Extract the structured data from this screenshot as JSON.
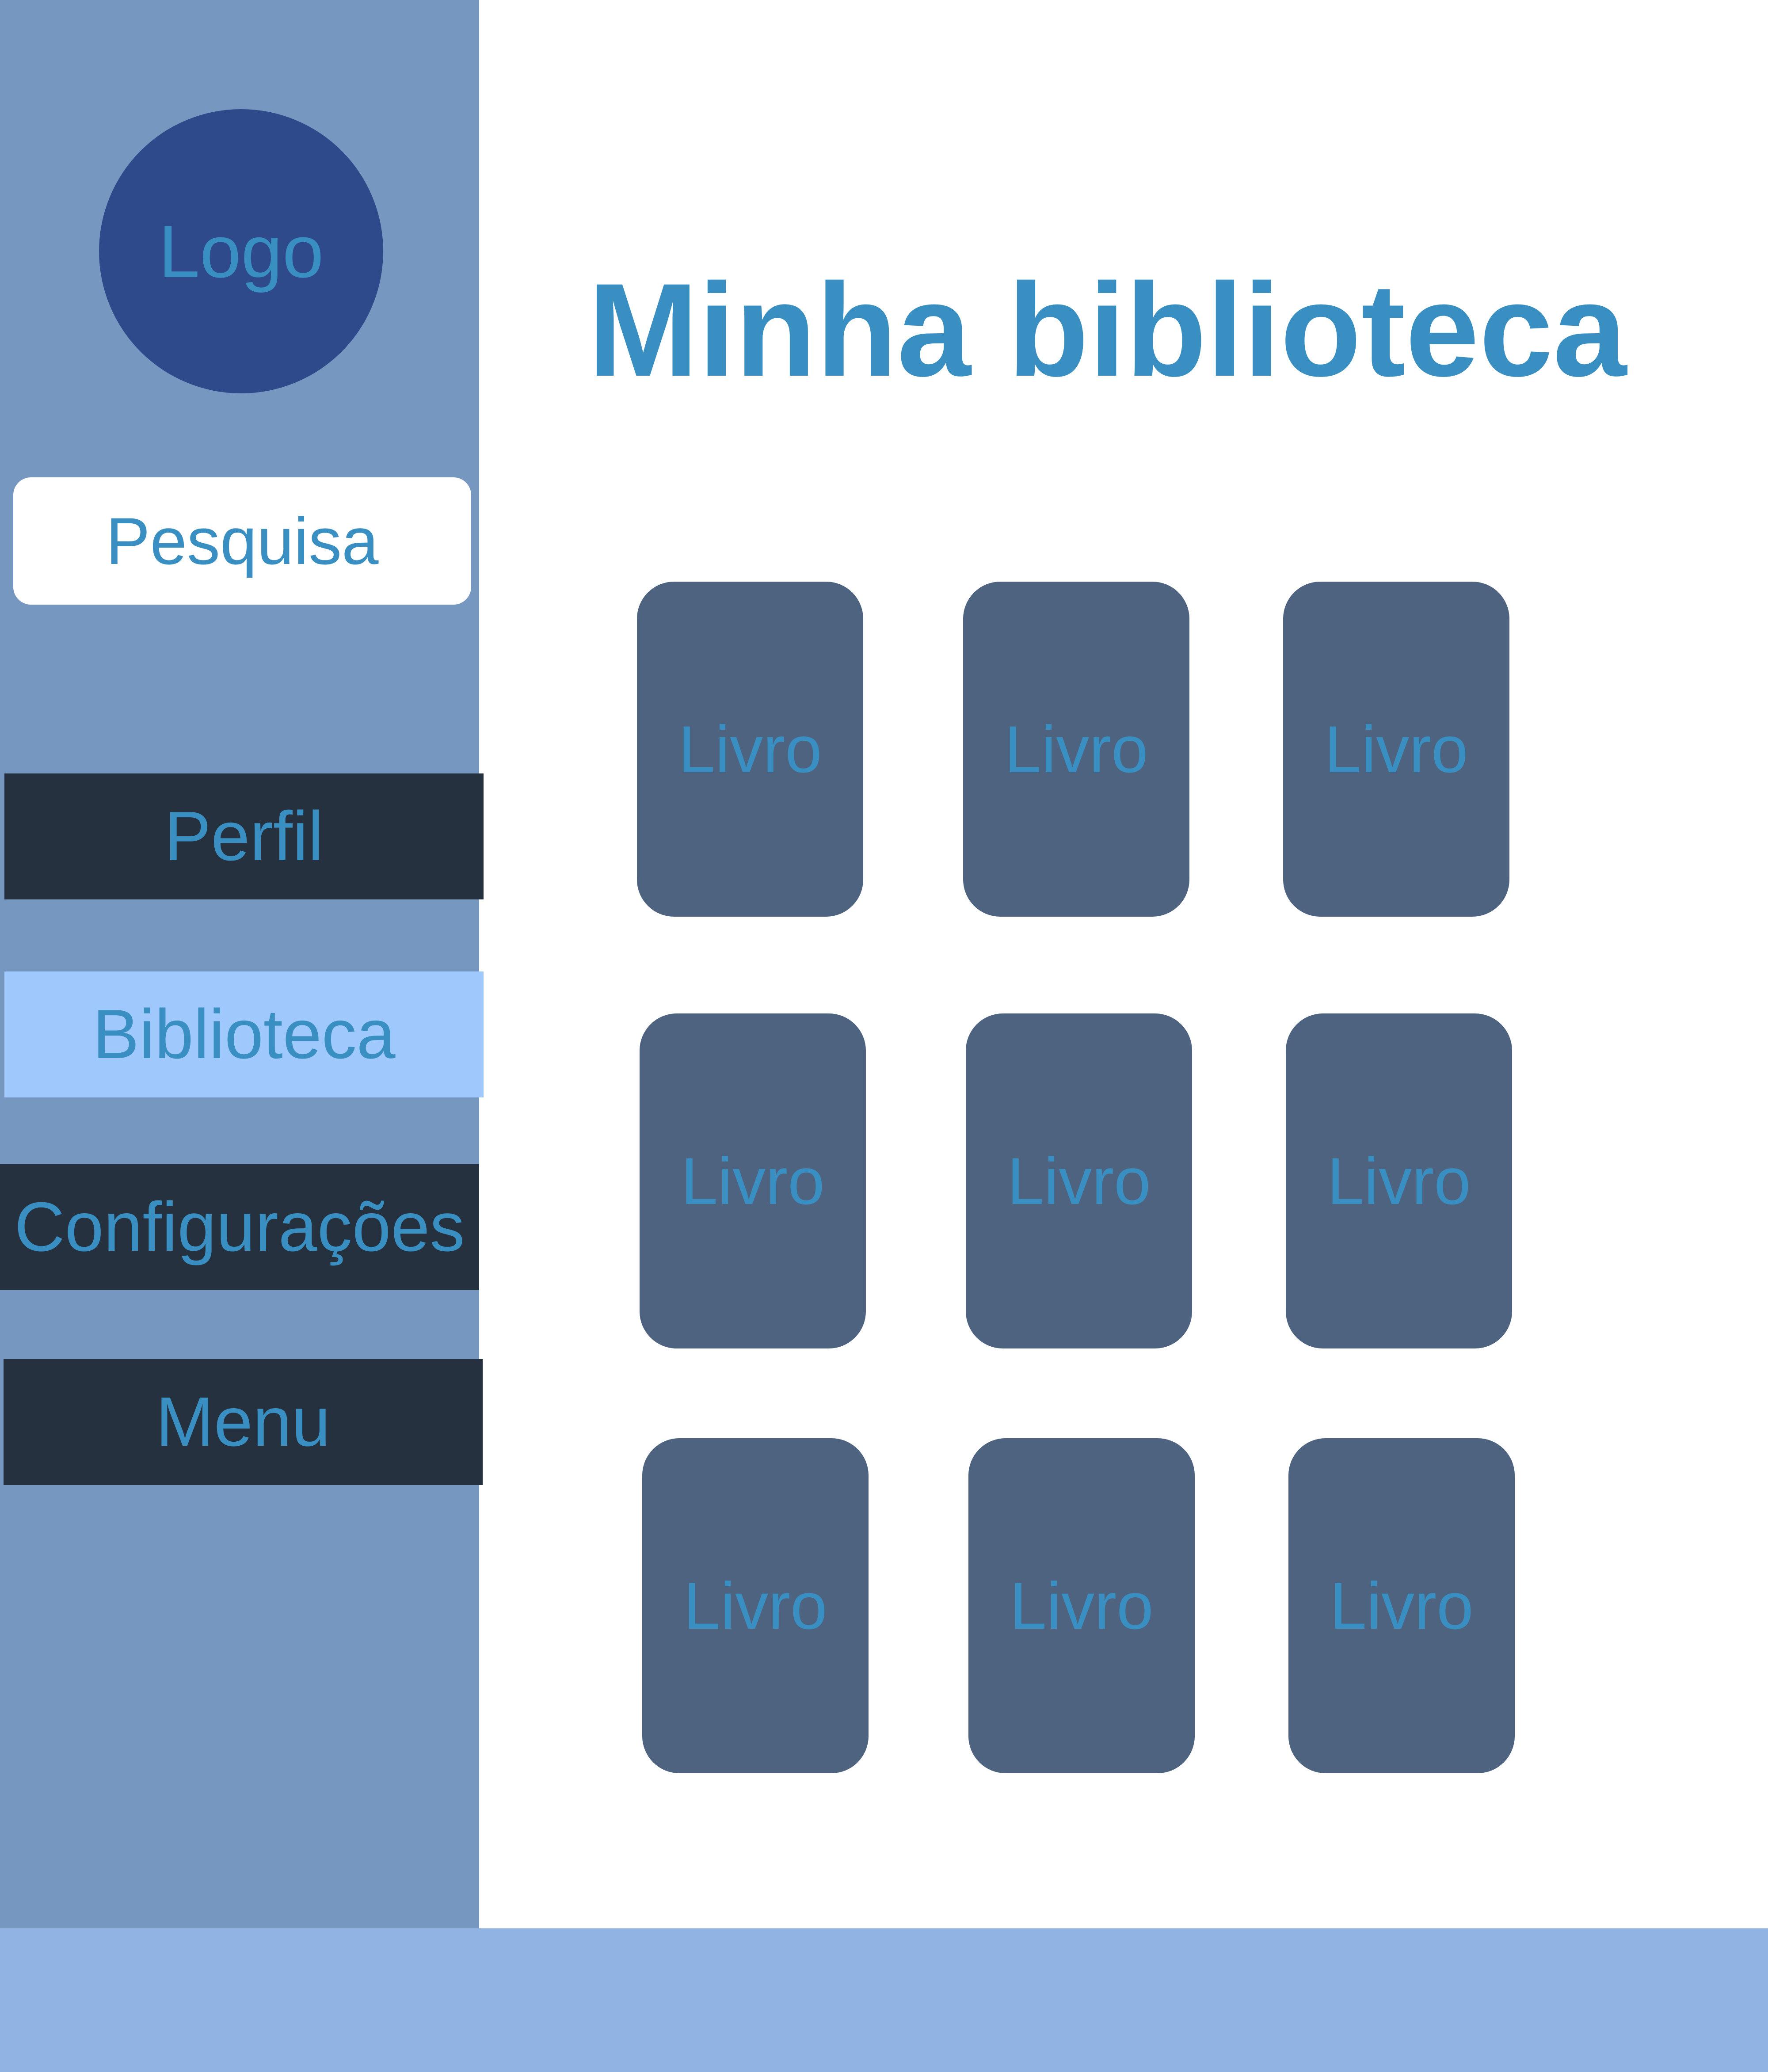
{
  "colors": {
    "sidebar": "#7697c0",
    "logo": "#2f4a8a",
    "text": "#3a8fc2",
    "nav_dark": "#25313e",
    "nav_active": "#9fc8fc",
    "book": "#4e637f",
    "footer": "#90b3e3"
  },
  "sidebar": {
    "logo_label": "Logo",
    "search_placeholder": "Pesquisa",
    "items": [
      {
        "label": "Perfil",
        "active": false
      },
      {
        "label": "Biblioteca",
        "active": true
      },
      {
        "label": "Configurações",
        "active": false
      },
      {
        "label": "Menu",
        "active": false
      }
    ]
  },
  "main": {
    "title": "Minha biblioteca",
    "books": [
      {
        "label": "Livro"
      },
      {
        "label": "Livro"
      },
      {
        "label": "Livro"
      },
      {
        "label": "Livro"
      },
      {
        "label": "Livro"
      },
      {
        "label": "Livro"
      },
      {
        "label": "Livro"
      },
      {
        "label": "Livro"
      },
      {
        "label": "Livro"
      }
    ]
  }
}
